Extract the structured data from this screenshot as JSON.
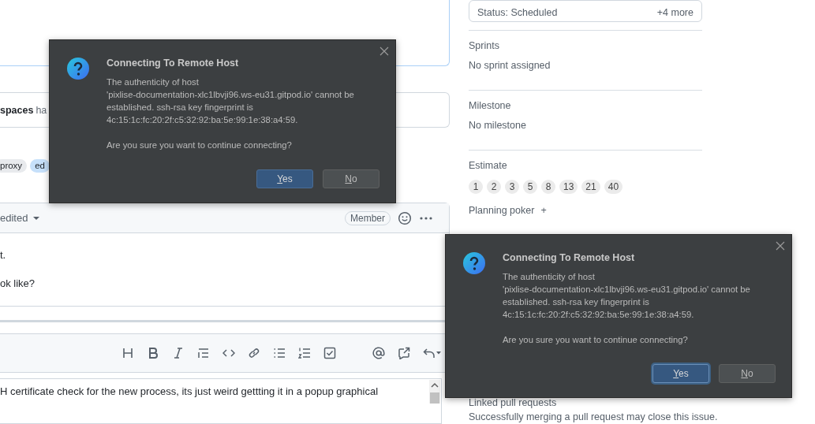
{
  "issue": {
    "notice": {
      "strong": "spaces",
      "rest": "ha"
    },
    "labels": [
      {
        "text": "proxy",
        "color": "#e8eaed"
      },
      {
        "text": "ed",
        "color": "#c6e0fa"
      }
    ],
    "comment": {
      "author_suffix": "edited",
      "role_badge": "Member",
      "lines": [
        "t.",
        "ok like?"
      ]
    },
    "composer": {
      "value": "H certificate check for the new process, its just weird gettting it in a popup graphical"
    }
  },
  "sidebar": {
    "status": {
      "text": "Status: Scheduled",
      "more": "+4 more"
    },
    "sections": [
      {
        "kind": "text",
        "heading": "Sprints",
        "value": "No sprint assigned"
      },
      {
        "kind": "text",
        "heading": "Milestone",
        "value": "No milestone"
      },
      {
        "kind": "chips",
        "heading": "Estimate",
        "options": [
          "1",
          "2",
          "3",
          "5",
          "8",
          "13",
          "21",
          "40"
        ]
      },
      {
        "kind": "action",
        "heading": "Planning poker",
        "action": "+"
      },
      {
        "kind": "text",
        "heading": "Linked pull requests",
        "value": "Successfully merging a pull request may close this issue."
      }
    ]
  },
  "dialogs": [
    {
      "title": "Connecting To Remote Host",
      "message": "The authenticity of host\n'pixlise-documentation-xlc1lbvji96.ws-eu31.gitpod.io' cannot be\nestablished. ssh-rsa key fingerprint is\n4c:15:1c:fc:20:2f:c5:32:92:ba:5e:99:1e:38:a4:59.",
      "question": "Are you sure you want to continue connecting?",
      "buttons": [
        {
          "label": "Yes",
          "selected": true,
          "focused": false
        },
        {
          "label": "No",
          "selected": false,
          "focused": false
        }
      ]
    },
    {
      "title": "Connecting To Remote Host",
      "message": "The authenticity of host\n'pixlise-documentation-xlc1lbvji96.ws-eu31.gitpod.io' cannot be\nestablished. ssh-rsa key fingerprint is\n4c:15:1c:fc:20:2f:c5:32:92:ba:5e:99:1e:38:a4:59.",
      "question": "Are you sure you want to continue connecting?",
      "buttons": [
        {
          "label": "Yes",
          "selected": true,
          "focused": true
        },
        {
          "label": "No",
          "selected": false,
          "focused": false
        }
      ]
    }
  ]
}
